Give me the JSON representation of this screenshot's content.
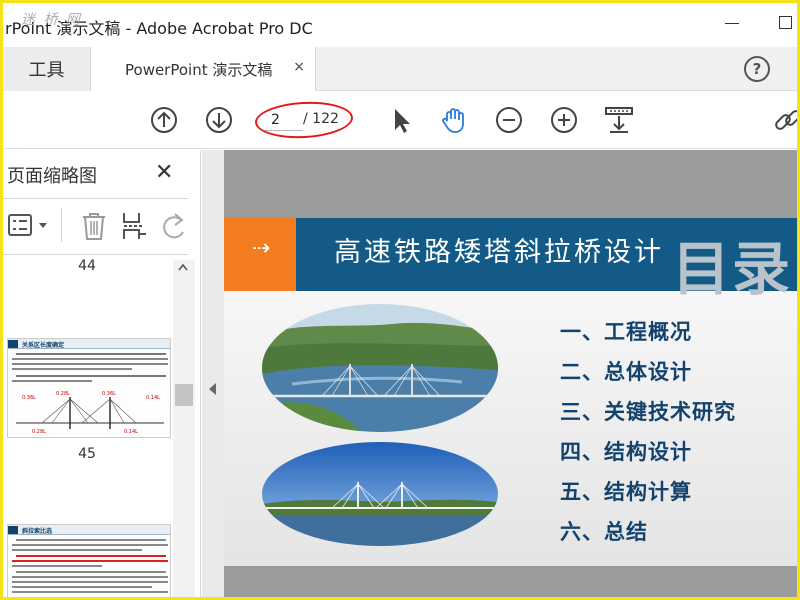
{
  "window": {
    "title": "rPoint 演示文稿 - Adobe Acrobat Pro DC",
    "watermark": "迷 桥 网"
  },
  "tabs": {
    "tools_label": "工具",
    "document_label": "PowerPoint 演示文稿",
    "close_glyph": "×",
    "help_glyph": "?"
  },
  "toolbar": {
    "current_page": "2",
    "total_pages": "/ 122"
  },
  "sidebar": {
    "title": "页面缩略图",
    "close_glyph": "✕",
    "thumbnails": [
      {
        "label": "44"
      },
      {
        "label": "45",
        "heading": "关系区长度确定",
        "fig_labels": [
          "0.36L",
          "0.28L",
          "0.36L",
          "0.14L",
          "0.28L",
          "0.14L"
        ]
      },
      {
        "heading": "斜拉索比选"
      }
    ]
  },
  "slide": {
    "title": "高速铁路矮塔斜拉桥设计",
    "mulu": "目录",
    "header_arrow": "⇢",
    "toc": [
      "一、工程概况",
      "二、总体设计",
      "三、关键技术研究",
      "四、结构设计",
      "五、结构计算",
      "六、总结"
    ]
  },
  "colors": {
    "frame_border": "#f4e21a",
    "page_ellipse": "#e01a1a",
    "slide_header": "#135a86",
    "slide_orange": "#f47c20",
    "toc_text": "#13436d",
    "hand_tool": "#2b7bd6"
  },
  "icons": {
    "prev": "arrow-up-circle-icon",
    "next": "arrow-down-circle-icon",
    "select": "cursor-arrow-icon",
    "hand": "hand-icon",
    "zoom_out": "zoom-out-icon",
    "zoom_in": "zoom-in-icon",
    "fit": "fit-page-icon",
    "link": "link-icon"
  }
}
